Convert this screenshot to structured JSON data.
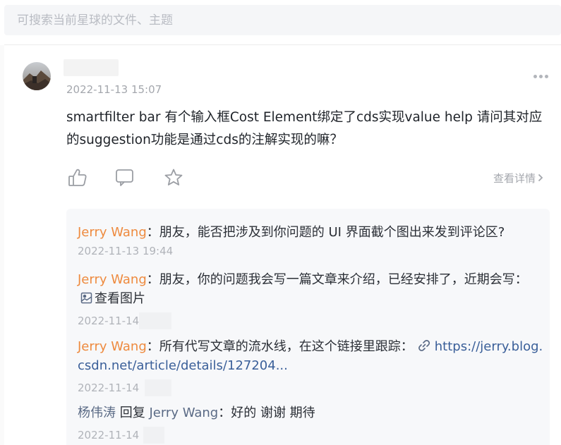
{
  "search": {
    "placeholder": "可搜索当前星球的文件、主题"
  },
  "post": {
    "time": "2022-11-13 15:07",
    "text": "smartfilter bar 有个输入框Cost Element绑定了cds实现value help 请问其对应的suggestion功能是通过cds的注解实现的嘛？",
    "details_label": "查看详情"
  },
  "icons": {
    "like": "thumbs-up-icon",
    "comment": "comment-bubble-icon",
    "favorite": "star-icon",
    "more": "more-dots-icon",
    "view_image": "image-icon",
    "link": "link-chain-icon"
  },
  "colors": {
    "commenter": "#ee8a3e",
    "reply_user": "#5a6a85",
    "link": "#3a5f99",
    "meta": "#a4a7ad"
  },
  "comments": [
    {
      "author": "Jerry Wang",
      "separator": "：",
      "text": "朋友，能否把涉及到你问题的 UI 界面截个图出来发到评论区?",
      "time": "2022-11-13 19:44"
    },
    {
      "author": "Jerry Wang",
      "separator": "：",
      "text": "朋友，你的问题我会写一篇文章来介绍，已经安排了，近期会写：",
      "link_label": "查看图片",
      "time": "2022-11-14"
    },
    {
      "author": "Jerry Wang",
      "separator": "：",
      "text": "所有代写文章的流水线，在这个链接里跟踪：",
      "url": "https://jerry.blog.csdn.net/article/details/127204...",
      "time": "2022-11-14"
    },
    {
      "author": "杨伟涛",
      "reply_word": "回复",
      "reply_to": "Jerry Wang",
      "separator": "：",
      "text": "好的 谢谢 期待",
      "time": "2022-11-14"
    }
  ]
}
